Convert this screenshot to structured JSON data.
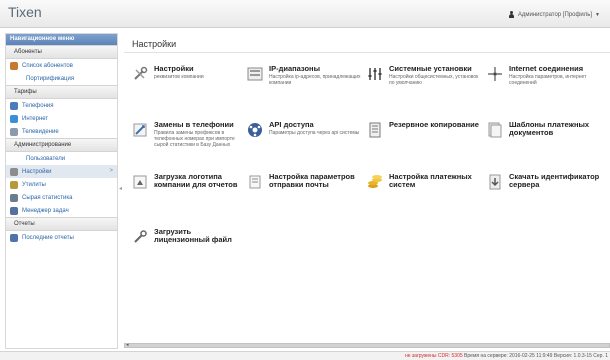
{
  "app": {
    "logo": "Tixen",
    "user": "Администратор [Профиль]"
  },
  "sidebar": {
    "header": "Навигационное меню",
    "sections": [
      {
        "title": "Абоненты",
        "items": [
          {
            "label": "Список абонентов",
            "icon": "users-icon",
            "color": "#c77a2f",
            "sub": false
          },
          {
            "label": "Портирификация",
            "icon": "",
            "color": "",
            "sub": true
          }
        ]
      },
      {
        "title": "Тарифы",
        "items": [
          {
            "label": "Телефония",
            "icon": "phone-icon",
            "color": "#4a7bbd",
            "sub": false
          },
          {
            "label": "Интернет",
            "icon": "globe-icon",
            "color": "#3a8fd6",
            "sub": false
          },
          {
            "label": "Телевидение",
            "icon": "tv-icon",
            "color": "#8a9bad",
            "sub": false
          }
        ]
      },
      {
        "title": "Администрирование",
        "items": [
          {
            "label": "Пользователи",
            "icon": "",
            "color": "",
            "sub": true
          },
          {
            "label": "Настройки",
            "icon": "wrench-icon",
            "color": "#8d8d8d",
            "sub": false,
            "active": true
          },
          {
            "label": "Утилиты",
            "icon": "tools-icon",
            "color": "#b59a3a",
            "sub": false
          },
          {
            "label": "Сырая статистика",
            "icon": "stats-icon",
            "color": "#6a7d90",
            "sub": false
          },
          {
            "label": "Менеджер задач",
            "icon": "tasks-icon",
            "color": "#5571a0",
            "sub": false
          }
        ]
      },
      {
        "title": "Отчеты",
        "items": [
          {
            "label": "Последние отчеты",
            "icon": "report-icon",
            "color": "#4f75a8",
            "sub": false
          }
        ]
      }
    ]
  },
  "main": {
    "title": "Настройки",
    "tiles": [
      {
        "title": "Настройки",
        "desc": "реквизитов компании",
        "icon": "settings-tools-icon",
        "col": 0,
        "row": 0
      },
      {
        "title": "IP-диапазоны",
        "desc": "Настройка ip-адресов, принадлежащих компании",
        "icon": "ip-range-icon",
        "col": 1,
        "row": 0
      },
      {
        "title": "Системные установки",
        "desc": "Настройки общесистемных, установок по умолчанию",
        "icon": "sliders-icon",
        "col": 2,
        "row": 0
      },
      {
        "title": "Internet соединения",
        "desc": "Настройка параметров, интернет соединений",
        "icon": "network-icon",
        "col": 3,
        "row": 0
      },
      {
        "title": "Замены в телефонии",
        "desc": "Правила замены префиксов в телефонных номерах при импорте сырой статистики в Базу Данных",
        "icon": "phone-replace-icon",
        "col": 0,
        "row": 1
      },
      {
        "title": "API доступа",
        "desc": "Параметры доступа через api системы",
        "icon": "api-icon",
        "col": 1,
        "row": 1
      },
      {
        "title": "Резервное копирование",
        "desc": "",
        "icon": "backup-icon",
        "col": 2,
        "row": 1
      },
      {
        "title": "Шаблоны платежных документов",
        "desc": "",
        "icon": "templates-icon",
        "col": 3,
        "row": 1
      },
      {
        "title": "Загрузка логотипа компании для отчетов",
        "desc": "",
        "icon": "logo-upload-icon",
        "col": 0,
        "row": 2
      },
      {
        "title": "Настройка параметров отправки почты",
        "desc": "",
        "icon": "mail-settings-icon",
        "col": 1,
        "row": 2
      },
      {
        "title": "Настройка платежных систем",
        "desc": "",
        "icon": "payment-icon",
        "col": 2,
        "row": 2
      },
      {
        "title": "Скачать идентификатор сервера",
        "desc": "",
        "icon": "download-icon",
        "col": 3,
        "row": 2
      },
      {
        "title": "Загрузить лицензионный файл",
        "desc": "",
        "icon": "license-icon",
        "col": 0,
        "row": 3
      }
    ]
  },
  "footer": {
    "warning": "не загружены CDR: 5305",
    "info": "Время на сервере: 2016-02-25 11:9:49 Версия: 1.0.3-15 Сер. 1"
  }
}
